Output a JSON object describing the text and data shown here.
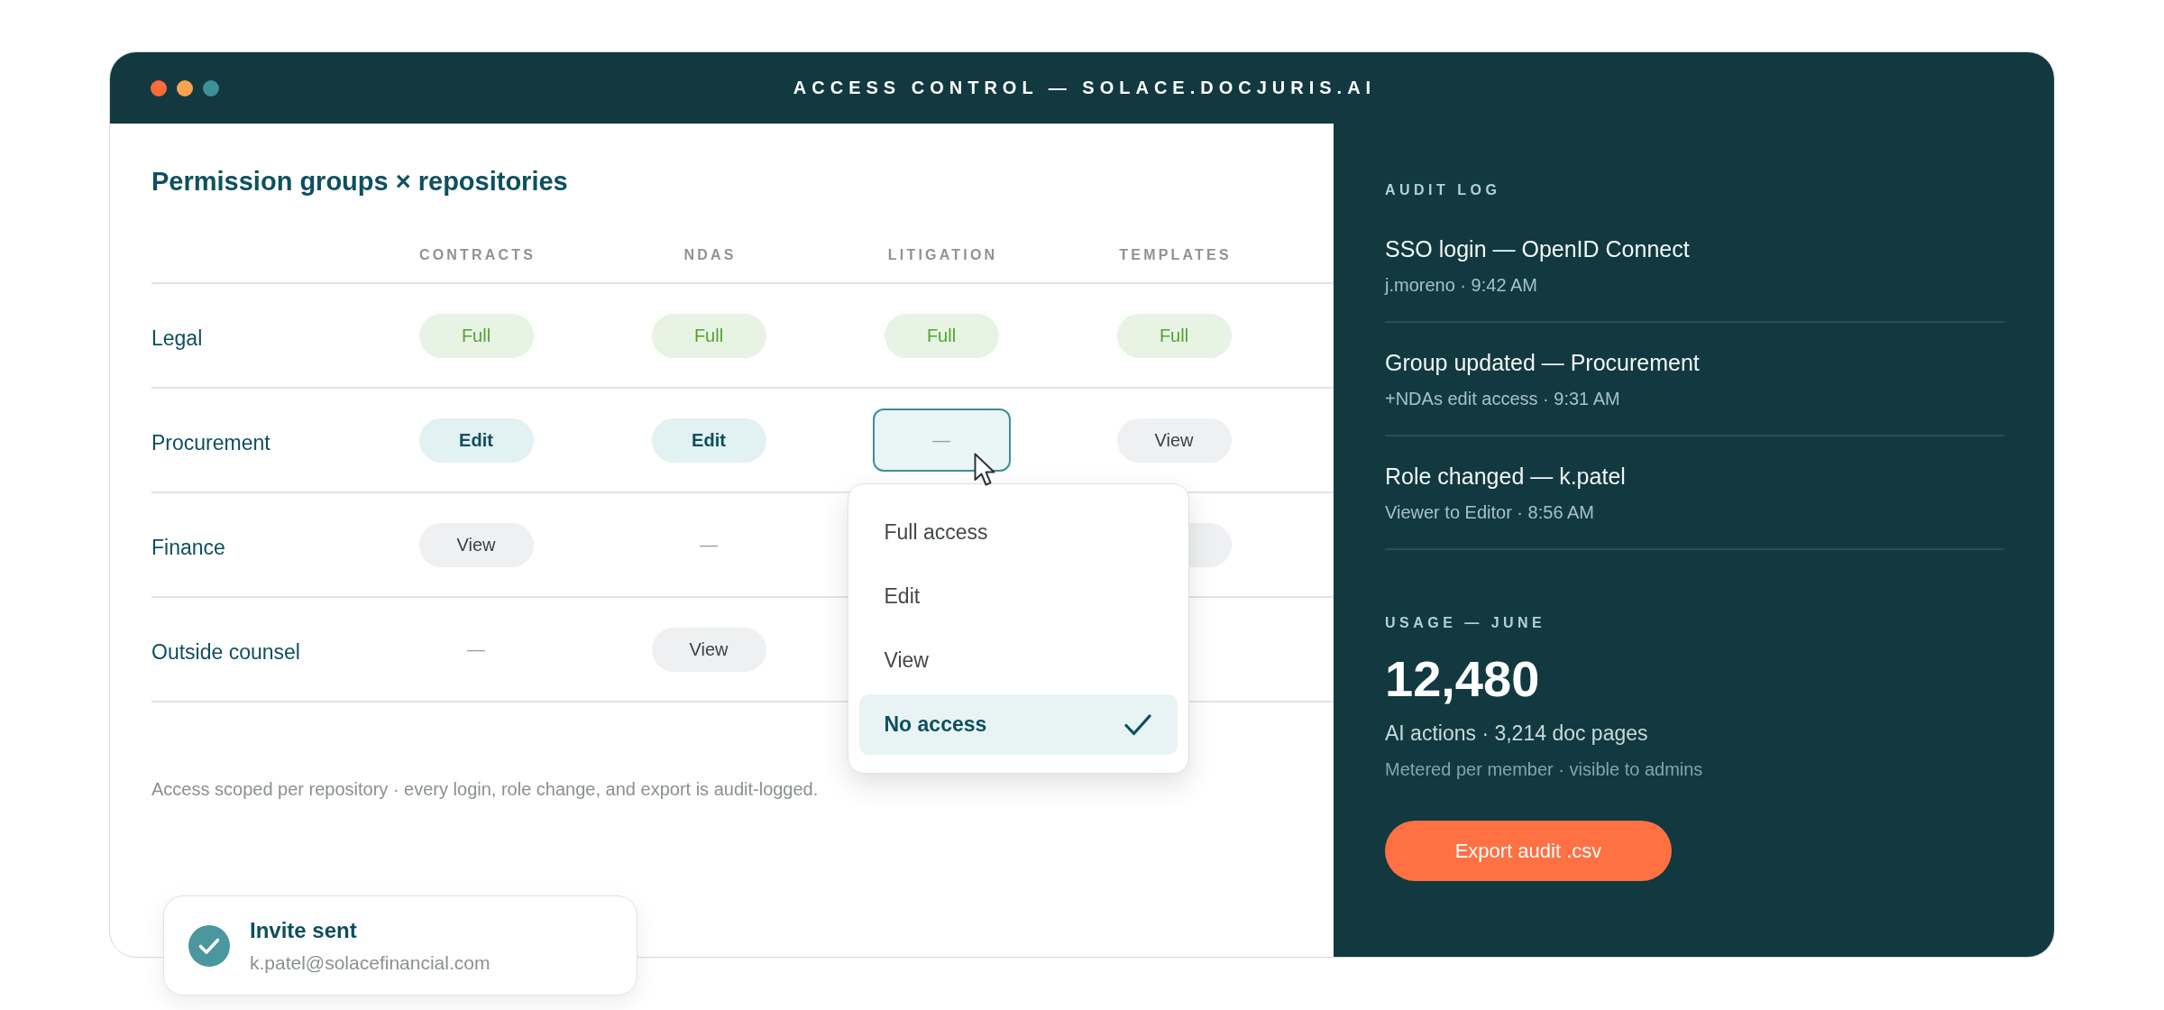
{
  "window": {
    "title": "ACCESS CONTROL — SOLACE.DOCJURIS.AI"
  },
  "permissions": {
    "title": "Permission groups × repositories",
    "columns": [
      "CONTRACTS",
      "NDAS",
      "LITIGATION",
      "TEMPLATES"
    ],
    "rows": [
      {
        "group": "Legal",
        "cells": [
          {
            "kind": "full",
            "label": "Full",
            "selected": false
          },
          {
            "kind": "full",
            "label": "Full",
            "selected": false
          },
          {
            "kind": "full",
            "label": "Full",
            "selected": false
          },
          {
            "kind": "full",
            "label": "Full",
            "selected": false
          }
        ]
      },
      {
        "group": "Procurement",
        "cells": [
          {
            "kind": "edit",
            "label": "Edit",
            "selected": false
          },
          {
            "kind": "edit",
            "label": "Edit",
            "selected": false
          },
          {
            "kind": "none",
            "label": "—",
            "selected": true
          },
          {
            "kind": "view",
            "label": "View",
            "selected": false
          }
        ]
      },
      {
        "group": "Finance",
        "cells": [
          {
            "kind": "view",
            "label": "View",
            "selected": false
          },
          {
            "kind": "none",
            "label": "—",
            "selected": false
          },
          null,
          {
            "kind": "view",
            "selected": false
          }
        ]
      },
      {
        "group": "Outside counsel",
        "cells": [
          {
            "kind": "none",
            "label": "—",
            "selected": false
          },
          {
            "kind": "view",
            "label": "View",
            "selected": false
          },
          null,
          null
        ]
      }
    ],
    "dropdown": {
      "options": [
        {
          "label": "Full access",
          "selected": false
        },
        {
          "label": "Edit",
          "selected": false
        },
        {
          "label": "View",
          "selected": false
        },
        {
          "label": "No access",
          "selected": true
        }
      ]
    },
    "footnote": "Access scoped per repository · every login, role change, and export is audit-logged."
  },
  "audit_log": {
    "title": "AUDIT LOG",
    "entries": [
      {
        "title": "SSO login — OpenID Connect",
        "detail": "j.moreno · 9:42 AM"
      },
      {
        "title": "Group updated — Procurement",
        "detail": "+NDAs edit access · 9:31 AM"
      },
      {
        "title": "Role changed — k.patel",
        "detail": "Viewer to Editor · 8:56 AM"
      }
    ]
  },
  "usage": {
    "title": "USAGE — JUNE",
    "value": "12,480",
    "detail": "AI actions · 3,214 doc pages",
    "note": "Metered per member · visible to admins"
  },
  "export_button": "Export audit .csv",
  "toast": {
    "title": "Invite sent",
    "detail": "k.patel@solacefinancial.com"
  }
}
